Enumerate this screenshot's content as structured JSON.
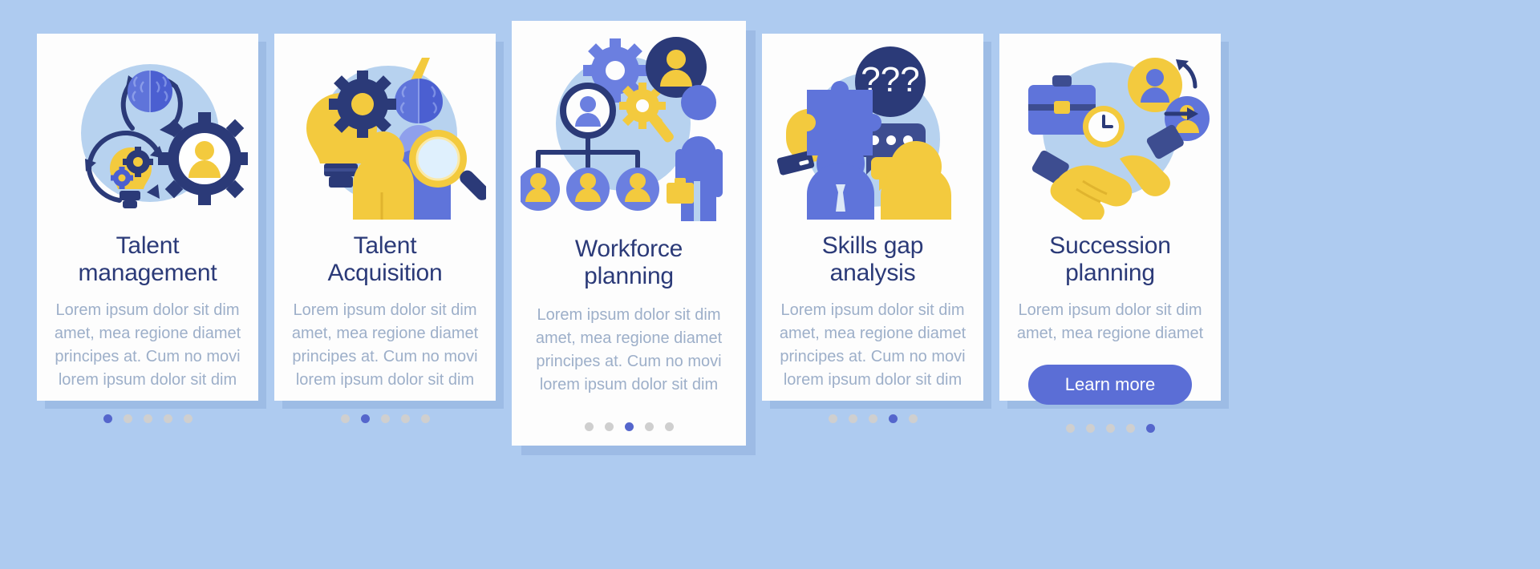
{
  "page": {
    "background_color": "#aecbf0",
    "card_background": "#fdfdfd",
    "title_color": "#2b3a78",
    "body_color": "#9dafc9",
    "accent_color": "#5b6ed6",
    "dot_inactive_color": "#cfcfcf",
    "yellow": "#f3ca3e",
    "light_blue": "#b7d2ef",
    "mid_blue": "#6b7fe0",
    "dark_blue": "#2b3a78"
  },
  "cards": [
    {
      "id": "talent-management",
      "title": "Talent\nmanagement",
      "description": "Lorem ipsum dolor sit dim\namet, mea regione diamet\nprincipes at. Cum no movi\nlorem ipsum dolor sit dim",
      "illustration": "brain-bulb-gear-user-cycle",
      "dots": {
        "count": 5,
        "active_index": 0
      },
      "has_button": false,
      "button_label": ""
    },
    {
      "id": "talent-acquisition",
      "title": "Talent\nAcquisition",
      "description": "Lorem ipsum dolor sit dim\namet, mea regione diamet\nprincipes at. Cum no movi\nlorem ipsum dolor sit dim",
      "illustration": "bulb-gear-brain-people-magnifier",
      "dots": {
        "count": 5,
        "active_index": 1
      },
      "has_button": false,
      "button_label": ""
    },
    {
      "id": "workforce-planning",
      "title": "Workforce\nplanning",
      "description": "Lorem ipsum dolor sit dim\namet, mea regione diamet\nprincipes at. Cum no movi\nlorem ipsum dolor sit dim",
      "illustration": "org-chart-gears-avatars-person",
      "dots": {
        "count": 5,
        "active_index": 2
      },
      "has_button": false,
      "button_label": ""
    },
    {
      "id": "skills-gap-analysis",
      "title": "Skills gap\nanalysis",
      "description": "Lorem ipsum dolor sit dim\namet, mea regione diamet\nprincipes at. Cum no movi\nlorem ipsum dolor sit dim",
      "illustration": "puzzle-hand-question-bubbles-people",
      "dots": {
        "count": 5,
        "active_index": 3
      },
      "has_button": false,
      "button_label": ""
    },
    {
      "id": "succession-planning",
      "title": "Succession\nplanning",
      "description": "Lorem ipsum dolor sit dim\namet, mea regione diamet",
      "illustration": "briefcase-clock-avatars-handshake",
      "dots": {
        "count": 5,
        "active_index": 4
      },
      "has_button": true,
      "button_label": "Learn more"
    }
  ]
}
